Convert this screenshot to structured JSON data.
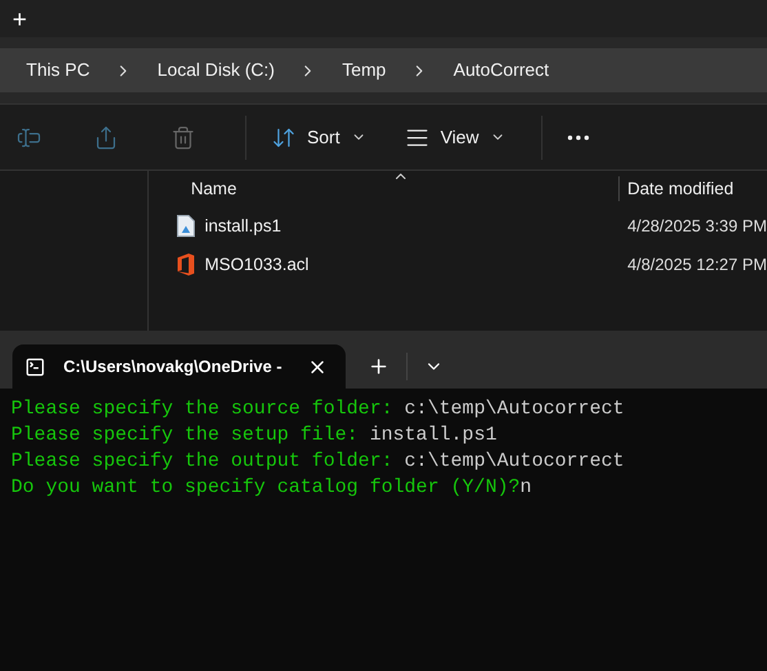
{
  "explorer": {
    "new_tab_label": "+",
    "breadcrumb": [
      "This PC",
      "Local Disk (C:)",
      "Temp",
      "AutoCorrect"
    ],
    "toolbar": [
      {
        "kind": "rename",
        "disabled": true
      },
      {
        "kind": "share",
        "disabled": true
      },
      {
        "kind": "delete",
        "disabled": true
      },
      {
        "kind": "sort",
        "label": "Sort",
        "disabled": false
      },
      {
        "kind": "view",
        "label": "View",
        "disabled": false
      },
      {
        "kind": "more",
        "disabled": false
      }
    ],
    "columns": [
      "Name",
      "Date modified"
    ],
    "files": [
      {
        "kind": "script",
        "name": "install.ps1",
        "date": "4/28/2025 3:39 PM"
      },
      {
        "kind": "office",
        "name": "MSO1033.acl",
        "date": "4/8/2025 12:27 PM"
      }
    ]
  },
  "terminal": {
    "tab": {
      "title": "C:\\Users\\novakg\\OneDrive - ",
      "selected": true
    },
    "lines": [
      {
        "prompt": "Please specify the source folder: ",
        "answer": "c:\\temp\\Autocorrect"
      },
      {
        "prompt": "Please specify the setup file: ",
        "answer": "install.ps1"
      },
      {
        "prompt": "Please specify the output folder: ",
        "answer": "c:\\temp\\Autocorrect"
      },
      {
        "prompt": "Do you want to specify catalog folder (Y/N)?",
        "answer": "n"
      }
    ]
  }
}
